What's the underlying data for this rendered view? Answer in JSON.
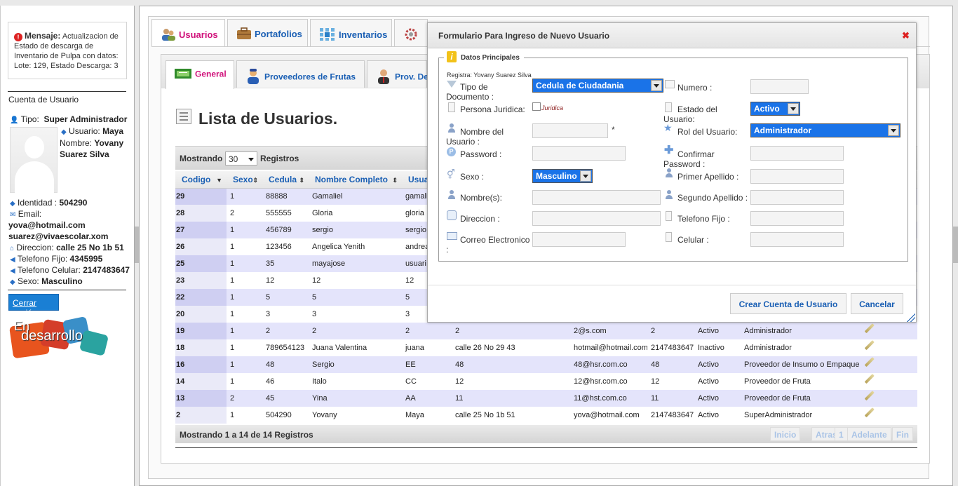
{
  "sidebar": {
    "message_title": "Mensaje:",
    "message_text": "Actualizacion de Estado de descarga de Inventario de Pulpa con datos: Lote: 129, Estado Descarga: 3",
    "account_heading": "Cuenta de Usuario",
    "tipo_label": "Tipo:",
    "tipo_value": "Super Administrador",
    "usuario_label": "Usuario:",
    "usuario_value": "Maya",
    "nombre_label": "Nombre:",
    "nombre_value": "Yovany Suarez Silva",
    "identidad_label": "Identidad :",
    "identidad_value": "504290",
    "email_label": "Email:",
    "email_value1": "yova@hotmail.com",
    "email_value2": "suarez@vivaescolar.xom",
    "direccion_label": "Direccion:",
    "direccion_value": "calle 25 No 1b 51",
    "telfijo_label": "Telefono Fijo:",
    "telfijo_value": "4345995",
    "celular_label": "Telefono Celular:",
    "celular_value": "2147483647",
    "sexo_label": "Sexo:",
    "sexo_value": "Masculino",
    "logout_label": "Cerrar sesión",
    "logo_text_top": "En",
    "logo_text_bottom": "desarrollo"
  },
  "top_tabs": [
    {
      "label": "Usuarios",
      "active": true
    },
    {
      "label": "Portafolios",
      "active": false
    },
    {
      "label": "Inventarios",
      "active": false
    }
  ],
  "sub_tabs": [
    {
      "label": "General",
      "active": true
    },
    {
      "label": "Proveedores de Frutas",
      "active": false
    },
    {
      "label": "Prov. De",
      "active": false
    }
  ],
  "list": {
    "title": "Lista de Usuarios.",
    "showing_prefix": "Mostrando",
    "page_length": "30",
    "showing_suffix": "Registros",
    "columns": [
      "Codigo",
      "Sexo",
      "Cedula",
      "Nombre Completo",
      "Usua"
    ],
    "rows": [
      {
        "codigo": "29",
        "sexo": "1",
        "cedula": "88888",
        "nombre": "Gamaliel",
        "usuario": "gamali",
        "direccion": "",
        "correo": "",
        "telefono": "",
        "estado": "",
        "rol": ""
      },
      {
        "codigo": "28",
        "sexo": "2",
        "cedula": "555555",
        "nombre": "Gloria",
        "usuario": "gloria",
        "direccion": "",
        "correo": "",
        "telefono": "",
        "estado": "",
        "rol": ""
      },
      {
        "codigo": "27",
        "sexo": "1",
        "cedula": "456789",
        "nombre": "sergio",
        "usuario": "sergio",
        "direccion": "",
        "correo": "",
        "telefono": "",
        "estado": "",
        "rol": ""
      },
      {
        "codigo": "26",
        "sexo": "1",
        "cedula": "123456",
        "nombre": "Angelica Yenith",
        "usuario": "andrea",
        "direccion": "",
        "correo": "",
        "telefono": "",
        "estado": "",
        "rol": ""
      },
      {
        "codigo": "25",
        "sexo": "1",
        "cedula": "35",
        "nombre": "mayajose",
        "usuario": "usuari",
        "direccion": "",
        "correo": "",
        "telefono": "",
        "estado": "",
        "rol": ""
      },
      {
        "codigo": "23",
        "sexo": "1",
        "cedula": "12",
        "nombre": "12",
        "usuario": "12",
        "direccion": "",
        "correo": "",
        "telefono": "",
        "estado": "",
        "rol": ""
      },
      {
        "codigo": "22",
        "sexo": "1",
        "cedula": "5",
        "nombre": "5",
        "usuario": "5",
        "direccion": "",
        "correo": "",
        "telefono": "",
        "estado": "",
        "rol": ""
      },
      {
        "codigo": "20",
        "sexo": "1",
        "cedula": "3",
        "nombre": "3",
        "usuario": "3",
        "direccion": "",
        "correo": "",
        "telefono": "",
        "estado": "",
        "rol": ""
      },
      {
        "codigo": "19",
        "sexo": "1",
        "cedula": "2",
        "nombre": "2",
        "usuario": "2",
        "direccion": "2",
        "correo": "2@s.com",
        "telefono": "2",
        "estado": "Activo",
        "rol": "Administrador"
      },
      {
        "codigo": "18",
        "sexo": "1",
        "cedula": "789654123",
        "nombre": "Juana Valentina",
        "usuario": "juana",
        "direccion": "calle 26 No 29 43",
        "correo": "hotmail@hotmail.com",
        "telefono": "2147483647",
        "estado": "Inactivo",
        "rol": "Administrador"
      },
      {
        "codigo": "16",
        "sexo": "1",
        "cedula": "48",
        "nombre": "Sergio",
        "usuario": "EE",
        "direccion": "48",
        "correo": "48@hsr.com.co",
        "telefono": "48",
        "estado": "Activo",
        "rol": "Proveedor de Insumo o Empaque"
      },
      {
        "codigo": "14",
        "sexo": "1",
        "cedula": "46",
        "nombre": "Italo",
        "usuario": "CC",
        "direccion": "12",
        "correo": "12@hsr.com.co",
        "telefono": "12",
        "estado": "Activo",
        "rol": "Proveedor de Fruta"
      },
      {
        "codigo": "13",
        "sexo": "2",
        "cedula": "45",
        "nombre": "Yina",
        "usuario": "AA",
        "direccion": "11",
        "correo": "11@hst.com.co",
        "telefono": "11",
        "estado": "Activo",
        "rol": "Proveedor de Fruta"
      },
      {
        "codigo": "2",
        "sexo": "1",
        "cedula": "504290",
        "nombre": "Yovany",
        "usuario": "Maya",
        "direccion": "calle 25 No 1b 51",
        "correo": "yova@hotmail.com",
        "telefono": "2147483647",
        "estado": "Activo",
        "rol": "SuperAdministrador"
      }
    ],
    "footer_info": "Mostrando 1 a 14 de 14 Registros",
    "pagination": [
      "Inicio",
      "Atras",
      "1",
      "Adelante",
      "Fin"
    ]
  },
  "dialog": {
    "title": "Formulario Para Ingreso de Nuevo Usuario",
    "close_glyph": "✖",
    "legend": "Datos Principales",
    "registra": "Registra: Yovany Suarez Silva",
    "tipo_doc_label": "Tipo de Documento :",
    "tipo_doc_value": "Cedula de Ciudadania",
    "numero_label": "Numero :",
    "persona_label": "Persona Juridica:",
    "juridica_label": "Juridica",
    "estado_label": "Estado del Usuario:",
    "estado_value": "Activo",
    "nombre_usuario_label": "Nombre del Usuario :",
    "required_mark": "*",
    "rol_label": "Rol del Usuario:",
    "rol_value": "Administrador",
    "password_label": "Password :",
    "confirmar_label": "Confirmar Password :",
    "sexo_label": "Sexo :",
    "sexo_value": "Masculino",
    "primer_apellido_label": "Primer Apellido :",
    "nombres_label": "Nombre(s):",
    "segundo_apellido_label": "Segundo Apellido :",
    "direccion_label": "Direccion :",
    "telefono_fijo_label": "Telefono Fijo :",
    "correo_label": "Correo Electronico :",
    "celular_label": "Celular :",
    "create_button": "Crear Cuenta de Usuario",
    "cancel_button": "Cancelar"
  }
}
